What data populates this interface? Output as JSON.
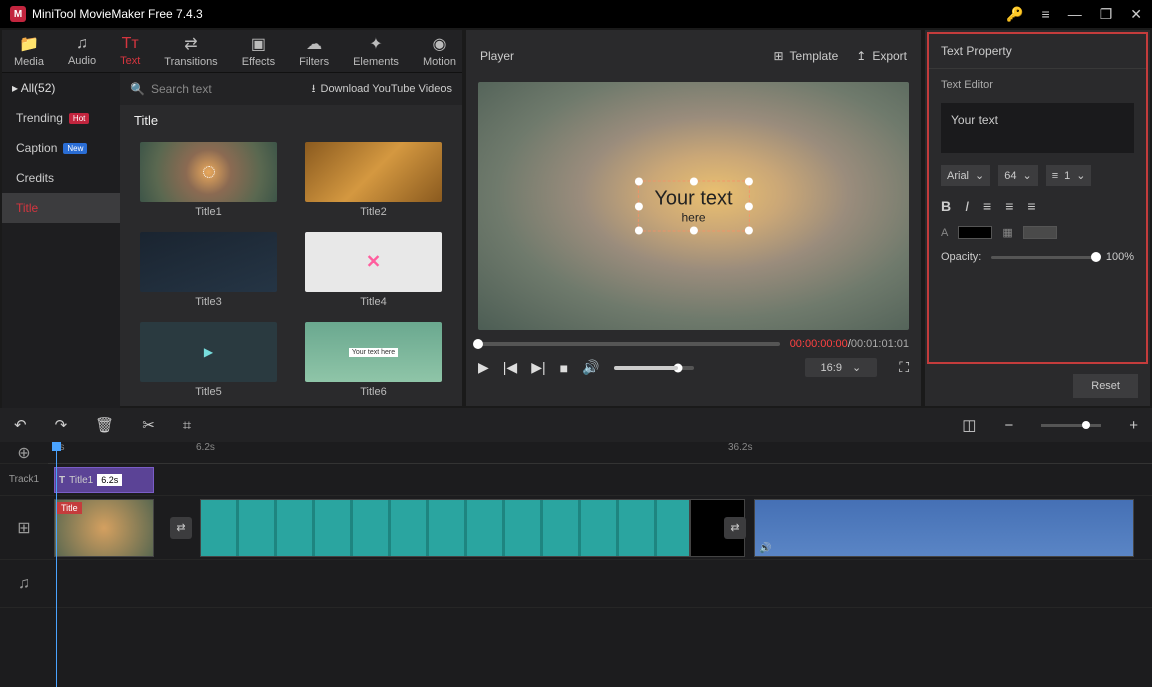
{
  "titlebar": {
    "title": "MiniTool MovieMaker Free 7.4.3"
  },
  "tabs": {
    "media": "Media",
    "audio": "Audio",
    "text": "Text",
    "transitions": "Transitions",
    "effects": "Effects",
    "filters": "Filters",
    "elements": "Elements",
    "motion": "Motion"
  },
  "sidecats": {
    "all": "All(52)",
    "trending": "Trending",
    "caption": "Caption",
    "credits": "Credits",
    "title": "Title",
    "badge_hot": "Hot",
    "badge_new": "New"
  },
  "gallery": {
    "search_placeholder": "Search text",
    "download": "Download YouTube Videos",
    "group_title": "Title",
    "items": [
      "Title1",
      "Title2",
      "Title3",
      "Title4",
      "Title5",
      "Title6"
    ],
    "tb6inner": "Your text here"
  },
  "player": {
    "label": "Player",
    "template": "Template",
    "export": "Export",
    "your_text": "Your text",
    "here": "here",
    "time_current": "00:00:00:00",
    "time_sep": " / ",
    "time_total": "00:01:01:01",
    "aspect": "16:9"
  },
  "right": {
    "header": "Text Property",
    "editor": "Text Editor",
    "text_value": "Your text",
    "font": "Arial",
    "size": "64",
    "line": "1",
    "opacity_label": "Opacity:",
    "opacity_value": "100%",
    "reset": "Reset"
  },
  "timeline": {
    "track1_label": "Track1",
    "ruler": {
      "t0": "0s",
      "t1": "6.2s",
      "t2": "36.2s"
    },
    "clip_title": "Title1",
    "clip_dur": "6.2s",
    "vclip_label": "Title"
  }
}
